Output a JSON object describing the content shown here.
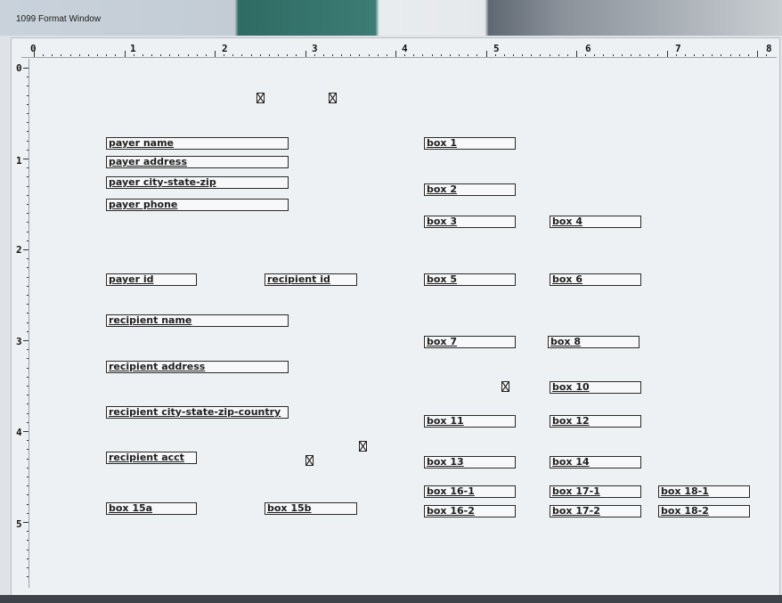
{
  "window": {
    "title": "1099 Format Window"
  },
  "ruler": {
    "top_labels": [
      "0",
      "1",
      "2",
      "3",
      "4",
      "5",
      "6",
      "7",
      "8"
    ],
    "left_labels": [
      "0",
      "1",
      "2",
      "3",
      "4",
      "5"
    ]
  },
  "fields": {
    "payer_name": "payer name",
    "payer_address": "payer address",
    "payer_city_state_zip": "payer city-state-zip",
    "payer_phone": "payer phone",
    "payer_id": "payer id",
    "recipient_id": "recipient id",
    "recipient_name": "recipient name",
    "recipient_address": "recipient address",
    "recipient_city_state_zip_country": "recipient city-state-zip-country",
    "recipient_acct": "recipient acct",
    "box_15a": "box 15a",
    "box_15b": "box 15b",
    "box_1": "box 1",
    "box_2": "box 2",
    "box_3": "box 3",
    "box_4": "box 4",
    "box_5": "box 5",
    "box_6": "box 6",
    "box_7": "box 7",
    "box_8": "box 8",
    "box_10": "box 10",
    "box_11": "box 11",
    "box_12": "box 12",
    "box_13": "box 13",
    "box_14": "box 14",
    "box_16_1": "box 16-1",
    "box_16_2": "box 16-2",
    "box_17_1": "box 17-1",
    "box_17_2": "box 17-2",
    "box_18_1": "box 18-1",
    "box_18_2": "box 18-2"
  },
  "checkbox_icon": "checkbox-x-icon",
  "colors": {
    "canvas": "#eef1f4",
    "field_border": "#2a2a2a"
  }
}
